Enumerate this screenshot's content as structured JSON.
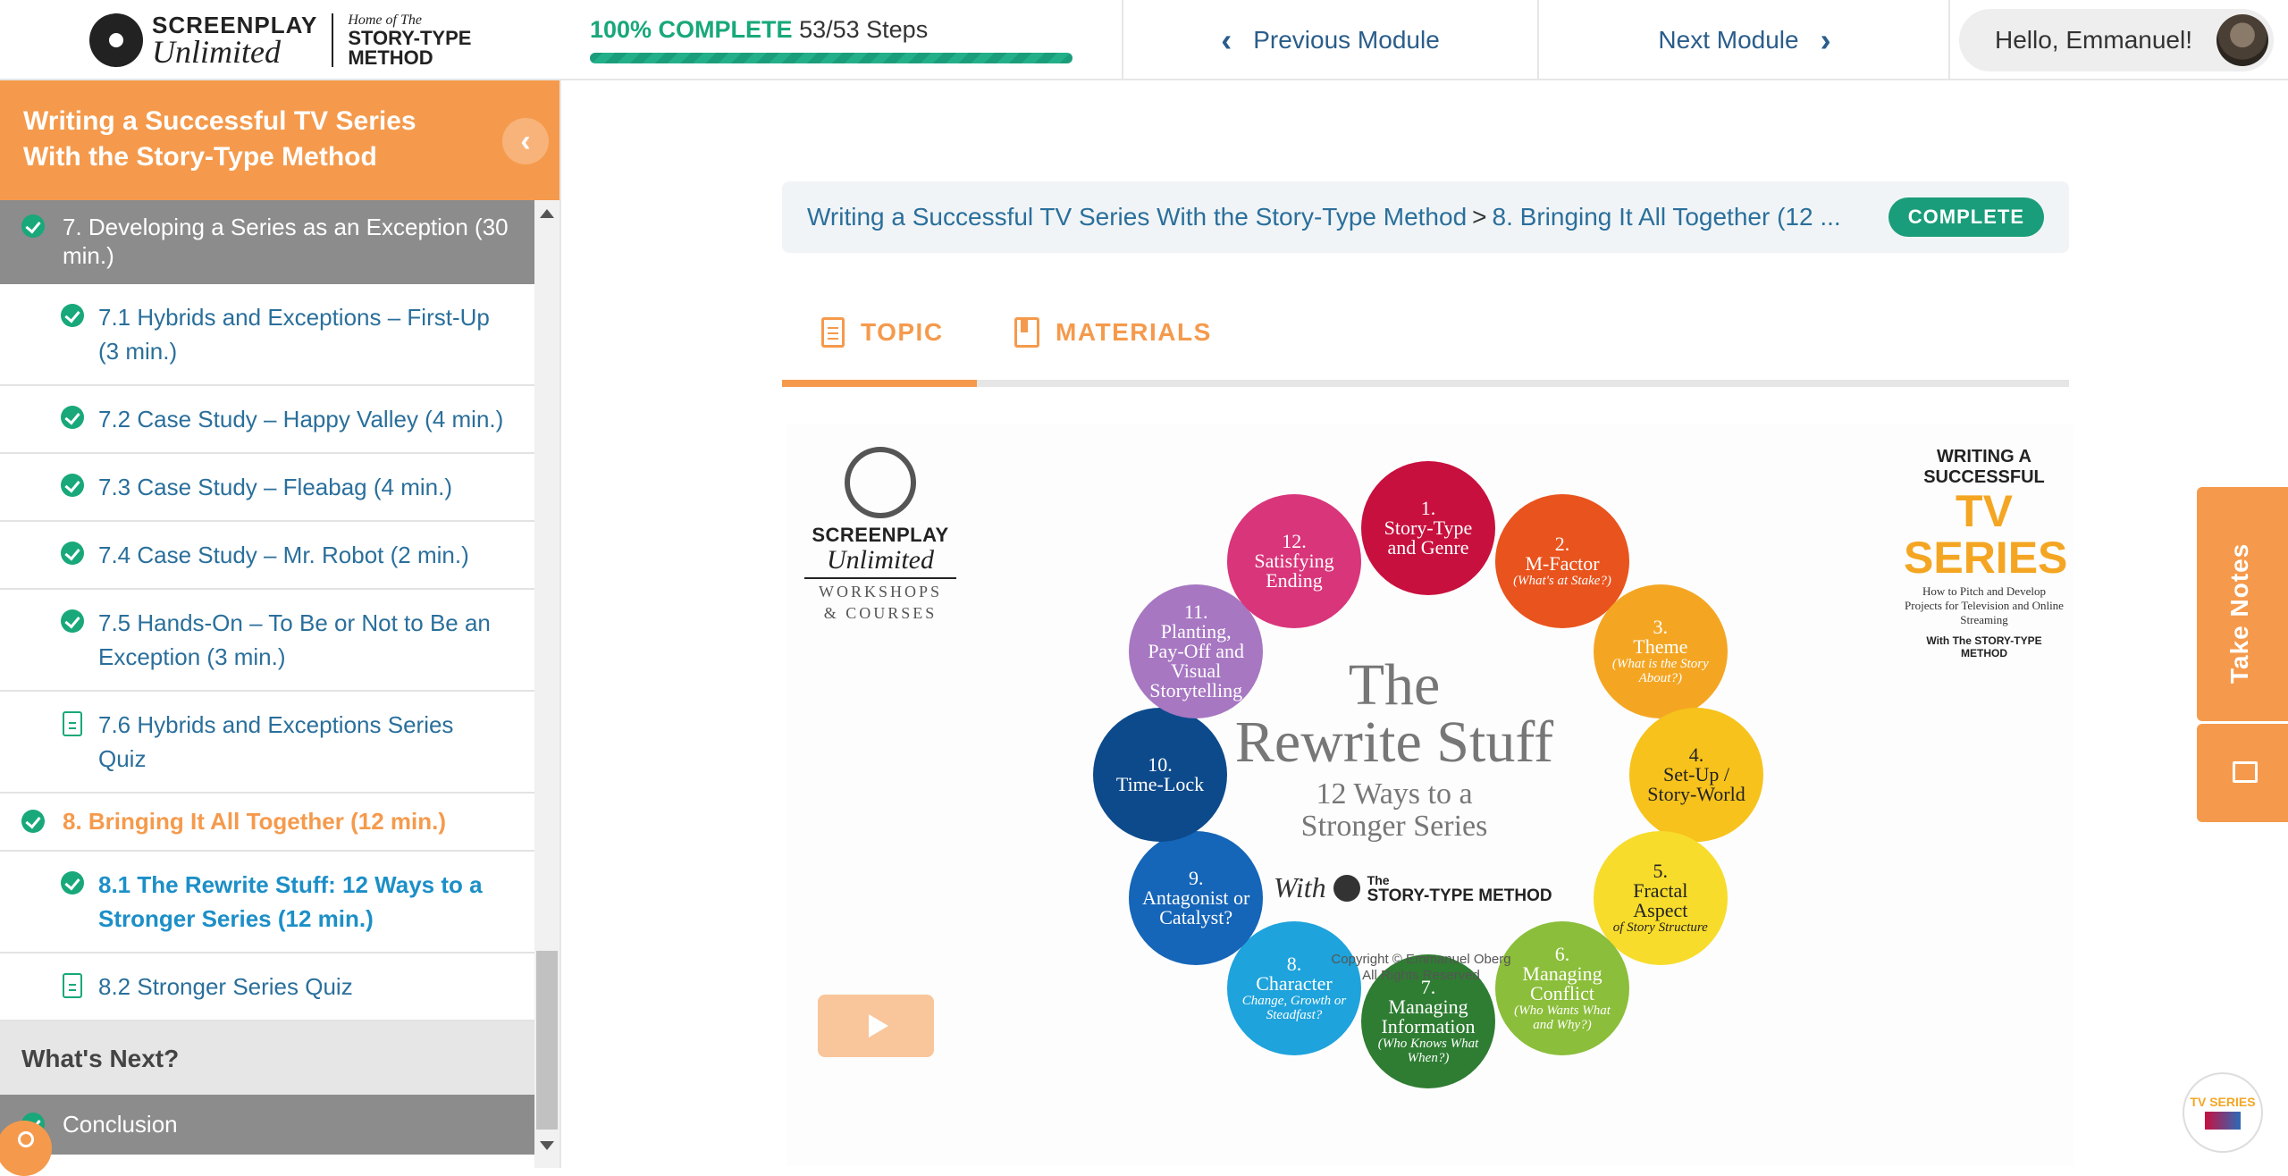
{
  "header": {
    "logo": {
      "line1": "SCREENPLAY",
      "line2": "Unlimited",
      "home": "Home of The",
      "stm1": "STORY-TYPE",
      "stm2": "METHOD"
    },
    "progress": {
      "percent_label": "100% COMPLETE",
      "steps_label": "53/53 Steps",
      "value": 1.0
    },
    "prev_label": "Previous Module",
    "next_label": "Next Module",
    "greeting": "Hello, Emmanuel!"
  },
  "sidebar": {
    "course_title": "Writing a Successful TV Series With the Story-Type Method",
    "section7": "7. Developing a Series as an Exception (30 min.)",
    "items7": [
      {
        "label": "7.1 Hybrids and Exceptions – First-Up (3 min.)"
      },
      {
        "label": "7.2 Case Study – Happy Valley (4 min.)"
      },
      {
        "label": "7.3 Case Study – Fleabag (4 min.)"
      },
      {
        "label": "7.4 Case Study – Mr. Robot (2 min.)"
      },
      {
        "label": "7.5 Hands-On – To Be or Not to Be an Exception (3 min.)"
      },
      {
        "label": "7.6 Hybrids and Exceptions Series Quiz"
      }
    ],
    "lesson8": "8. Bringing It All Together (12 min.)",
    "items8": [
      {
        "label": "8.1 The Rewrite Stuff: 12 Ways to a Stronger Series (12 min.)"
      },
      {
        "label": "8.2 Stronger Series Quiz"
      }
    ],
    "whats_next": "What's Next?",
    "conclusion": "Conclusion"
  },
  "breadcrumb": {
    "course": "Writing a Successful TV Series With the Story-Type Method",
    "sep": ">",
    "lesson": "8. Bringing It All Together (12 ...",
    "badge": "COMPLETE"
  },
  "tabs": {
    "topic": "TOPIC",
    "materials": "MATERIALS"
  },
  "video": {
    "logo": {
      "t1": "SCREENPLAY",
      "t2": "Unlimited",
      "t3a": "WORKSHOPS",
      "t3b": "& COURSES"
    },
    "cover": {
      "r1": "WRITING A SUCCESSFUL",
      "r2": "TV SERIES",
      "r3": "How to Pitch and Develop Projects for Television and Online Streaming",
      "r4": "With The STORY-TYPE METHOD"
    },
    "title_big1": "The",
    "title_big2": "Rewrite Stuff",
    "title_med1": "12 Ways to a",
    "title_med2": "Stronger Series",
    "with": "With",
    "stm_the": "The",
    "stm": "STORY-TYPE METHOD",
    "copyright1": "Copyright © Emmanuel Oberg",
    "copyright2": "All Rights Reserved",
    "circles": [
      {
        "n": "1.",
        "t": "Story-Type and Genre",
        "s": "",
        "color": "#c8103e"
      },
      {
        "n": "2.",
        "t": "M-Factor",
        "s": "(What's at Stake?)",
        "color": "#e9531d"
      },
      {
        "n": "3.",
        "t": "Theme",
        "s": "(What is the Story About?)",
        "color": "#f4a623"
      },
      {
        "n": "4.",
        "t": "Set-Up / Story-World",
        "s": "",
        "color": "#f7c21b"
      },
      {
        "n": "5.",
        "t": "Fractal Aspect",
        "s": "of Story Structure",
        "color": "#f7dc2b"
      },
      {
        "n": "6.",
        "t": "Managing Conflict",
        "s": "(Who Wants What and Why?)",
        "color": "#8bbe3a"
      },
      {
        "n": "7.",
        "t": "Managing Information",
        "s": "(Who Knows What When?)",
        "color": "#2e7d32"
      },
      {
        "n": "8.",
        "t": "Character",
        "s": "Change, Growth or Steadfast?",
        "color": "#1ea3dc"
      },
      {
        "n": "9.",
        "t": "Antagonist or Catalyst?",
        "s": "",
        "color": "#1565b8"
      },
      {
        "n": "10.",
        "t": "Time-Lock",
        "s": "",
        "color": "#0d4a8c"
      },
      {
        "n": "11.",
        "t": "Planting, Pay-Off and Visual Storytelling",
        "s": "",
        "color": "#a777c2"
      },
      {
        "n": "12.",
        "t": "Satisfying Ending",
        "s": "",
        "color": "#d9357a"
      }
    ]
  },
  "notes": {
    "label": "Take Notes"
  },
  "thumb": {
    "label": "TV SERIES"
  }
}
